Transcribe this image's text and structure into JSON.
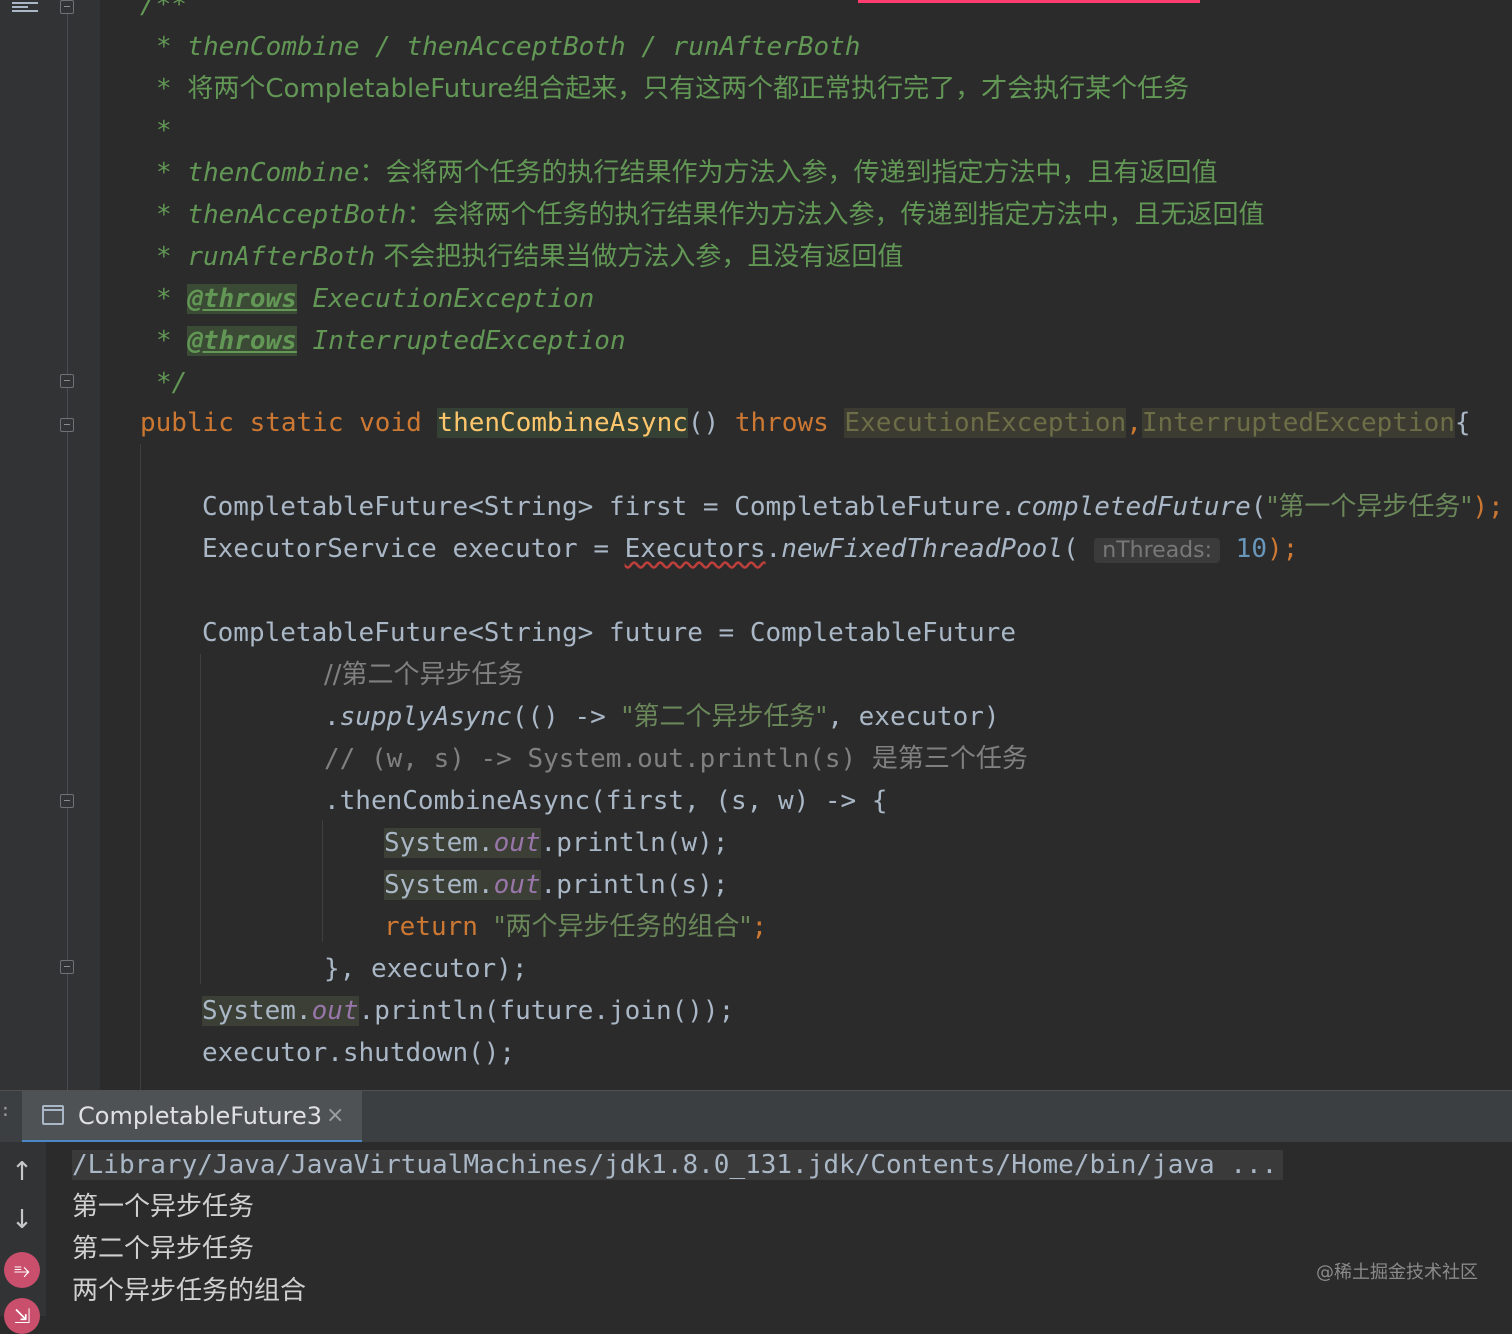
{
  "editor": {
    "javadoc": {
      "open": "/**",
      "line1": "* thenCombine / thenAcceptBoth / runAfterBoth",
      "line2_prefix": "* ",
      "line2": "将两个CompletableFuture组合起来，只有这两个都正常执行完了，才会执行某个任务",
      "star": "*",
      "line4_name": "thenCombine",
      "line4_desc": "：会将两个任务的执行结果作为方法入参，传递到指定方法中，且有返回值",
      "line5_name": "thenAcceptBoth",
      "line5_desc": "：会将两个任务的执行结果作为方法入参，传递到指定方法中，且无返回值",
      "line6_name": "runAfterBoth",
      "line6_desc": " 不会把执行结果当做方法入参，且没有返回值",
      "throws_tag": "@throws",
      "throws1": "ExecutionException",
      "throws2": "InterruptedException",
      "close": "*/"
    },
    "signature": {
      "modifiers": "public static void ",
      "method": "thenCombineAsync",
      "parens": "() ",
      "throws": "throws ",
      "exc1": "ExecutionException",
      "comma": ",",
      "exc2": "InterruptedException",
      "brace": "{"
    },
    "code": {
      "first_a": "CompletableFuture<String> first = CompletableFuture.",
      "first_method": "completedFuture",
      "first_b": "(",
      "first_str": "\"第一个异步任务\"",
      "first_c": ");",
      "exec_a": "ExecutorService executor = ",
      "exec_class": "Executors",
      "exec_dot": ".",
      "exec_method": "newFixedThreadPool",
      "exec_paren": "( ",
      "exec_hint": "nThreads:",
      "exec_num": "10",
      "exec_end": ");",
      "future_a": "CompletableFuture<String> future = CompletableFuture",
      "comment2": "//第二个异步任务",
      "supply_dot": ".",
      "supply_method": "supplyAsync",
      "supply_a": "(() -> ",
      "supply_str": "\"第二个异步任务\"",
      "supply_b": ", executor)",
      "comment3_a": "// (w, s) -> System.out.println(s) ",
      "comment3_b": "是第三个任务",
      "combine": ".thenCombineAsync(first, (s, w) -> {",
      "sys": "System.",
      "out": "out",
      "println_w": ".println(w);",
      "println_s": ".println(s);",
      "ret_kw": "return ",
      "ret_str": "\"两个异步任务的组合\"",
      "ret_end": ";",
      "close_lambda": "}, executor);",
      "join_b": ".println(future.join());",
      "shutdown": "executor.shutdown();"
    }
  },
  "run_panel": {
    "tab_label": "CompletableFuture3",
    "close_glyph": "×",
    "side_up": "↑",
    "side_down": "↓",
    "side_wrap": "⥱",
    "side_more": "⇲"
  },
  "console": {
    "command": "/Library/Java/JavaVirtualMachines/jdk1.8.0_131.jdk/Contents/Home/bin/java ...",
    "output": [
      "第一个异步任务",
      "第二个异步任务",
      "两个异步任务的组合"
    ]
  },
  "watermark": "@稀土掘金技术社区",
  "colors": {
    "background": "#2b2b2b",
    "comment": "#629755",
    "keyword": "#cc7832",
    "string": "#6a8759",
    "number": "#6897bb",
    "field": "#9876aa",
    "method": "#ffc66d",
    "tab_accent": "#4a88c7"
  }
}
